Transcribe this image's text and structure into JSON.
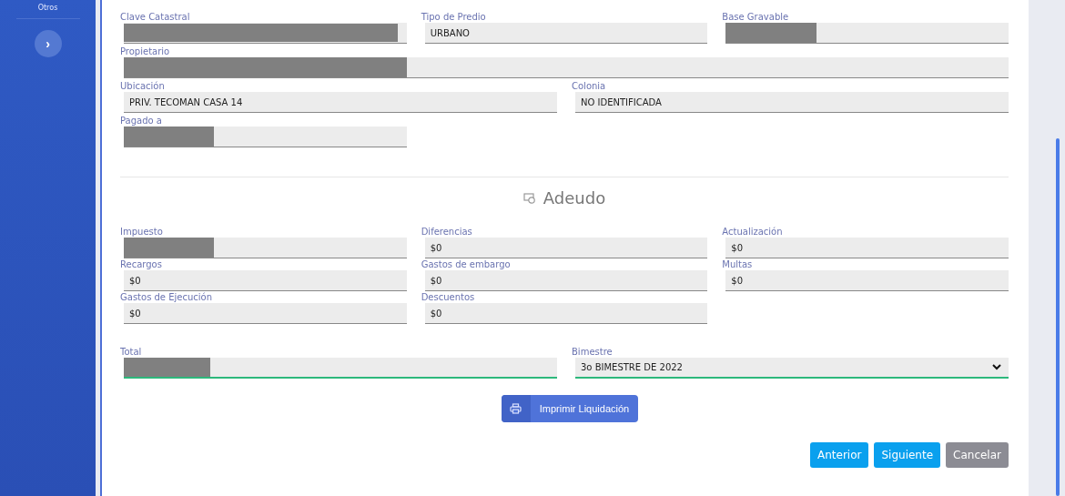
{
  "sidebar": {
    "label": "Otros",
    "toggle": "›"
  },
  "property_rows": [
    {
      "kind": "thirds",
      "fields": [
        {
          "label": "Clave Catastral",
          "redacted": true
        },
        {
          "label": "Tipo de Predio",
          "value": "URBANO",
          "redacted": false
        },
        {
          "label": "Base Gravable",
          "redacted": true
        }
      ]
    },
    {
      "kind": "full",
      "fields": [
        {
          "label": "Propietario",
          "redacted": true
        }
      ]
    },
    {
      "kind": "halves",
      "fields": [
        {
          "label": "Ubicación",
          "value": "PRIV. TECOMAN CASA 14",
          "redacted": false
        },
        {
          "label": "Colonia",
          "value": "NO IDENTIFICADA",
          "redacted": false
        }
      ]
    },
    {
      "kind": "thirds",
      "fields": [
        {
          "label": "Pagado a",
          "redacted": true
        }
      ]
    }
  ],
  "debt": {
    "title": "Adeudo",
    "fields": [
      {
        "label": "Impuesto",
        "redacted": true
      },
      {
        "label": "Diferencias",
        "value": "$0",
        "redacted": false
      },
      {
        "label": "Actualización",
        "value": "$0",
        "redacted": false
      },
      {
        "label": "Recargos",
        "value": "$0",
        "redacted": false
      },
      {
        "label": "Gastos de embargo",
        "value": "$0",
        "redacted": false
      },
      {
        "label": "Multas",
        "value": "$0",
        "redacted": false
      },
      {
        "label": "Gastos de Ejecución",
        "value": "$0",
        "redacted": false
      },
      {
        "label": "Descuentos",
        "value": "$0",
        "redacted": false
      }
    ]
  },
  "total": {
    "label": "Total",
    "redacted": true
  },
  "bimestre": {
    "label": "Bimestre",
    "value": "3o BIMESTRE DE 2022"
  },
  "print_button": "Imprimir Liquidación",
  "buttons": [
    {
      "label": "Anterior",
      "kind": "primary"
    },
    {
      "label": "Siguiente",
      "kind": "primary"
    },
    {
      "label": "Cancelar",
      "kind": "secondary"
    }
  ]
}
